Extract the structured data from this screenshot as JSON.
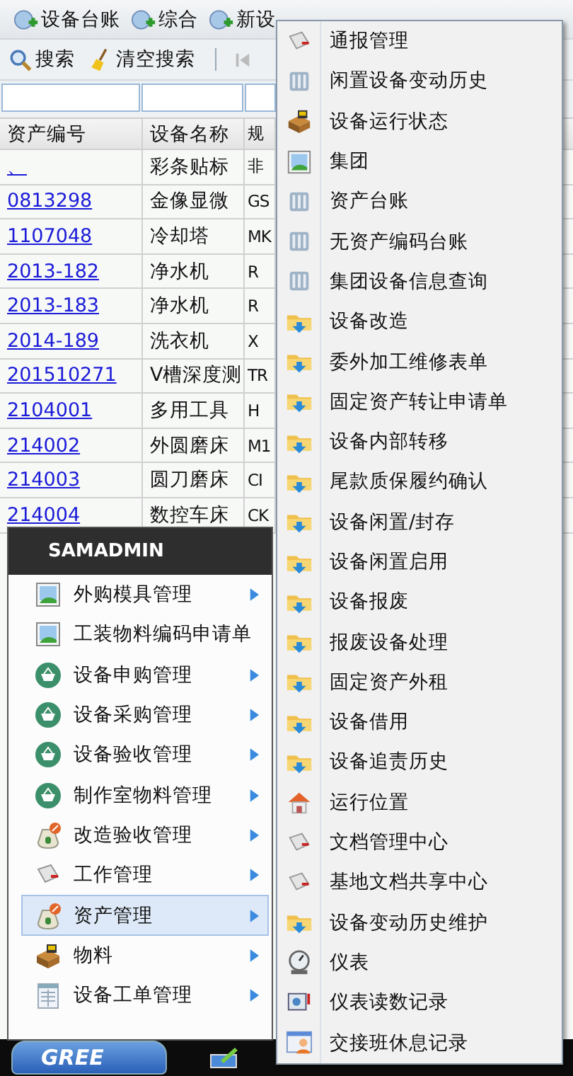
{
  "toolbar_tabs": [
    {
      "label": "设备台账"
    },
    {
      "label": "综合"
    },
    {
      "label": "新设"
    }
  ],
  "search_bar": {
    "buttons": [
      {
        "label": "搜索",
        "kind": "search"
      },
      {
        "label": "清空搜索",
        "kind": "broom"
      }
    ]
  },
  "table": {
    "columns": [
      "资产编号",
      "设备名称",
      "规"
    ],
    "rows": [
      [
        "、",
        "彩条贴标",
        "非"
      ],
      [
        "0813298",
        "金像显微",
        "GS"
      ],
      [
        "1107048",
        "冷却塔",
        "MK"
      ],
      [
        "2013-182",
        "净水机",
        "R"
      ],
      [
        "2013-183",
        "净水机",
        "R"
      ],
      [
        "2014-189",
        "洗衣机",
        "X"
      ],
      [
        "201510271",
        "V槽深度测",
        "TR"
      ],
      [
        "2104001",
        "多用工具",
        "H"
      ],
      [
        "214002",
        "外圆磨床",
        "M1"
      ],
      [
        "214003",
        "圆刀磨床",
        "CI"
      ],
      [
        "214004",
        "数控车床",
        "CK"
      ]
    ]
  },
  "start_menu": {
    "user": "SAMADMIN",
    "items": [
      {
        "label": "外购模具管理",
        "kind": "image",
        "submenu": true,
        "selected": false
      },
      {
        "label": "工装物料编码申请单",
        "kind": "image",
        "submenu": false,
        "selected": false
      },
      {
        "label": "设备申购管理",
        "kind": "basket",
        "submenu": true,
        "selected": false
      },
      {
        "label": "设备采购管理",
        "kind": "basket",
        "submenu": true,
        "selected": false
      },
      {
        "label": "设备验收管理",
        "kind": "basket",
        "submenu": true,
        "selected": false
      },
      {
        "label": "制作室物料管理",
        "kind": "basket",
        "submenu": true,
        "selected": false
      },
      {
        "label": "改造验收管理",
        "kind": "moneybag",
        "submenu": true,
        "selected": false
      },
      {
        "label": "工作管理",
        "kind": "doc",
        "submenu": true,
        "selected": false
      },
      {
        "label": "资产管理",
        "kind": "moneybag",
        "submenu": true,
        "selected": true
      },
      {
        "label": "物料",
        "kind": "box",
        "submenu": true,
        "selected": false
      },
      {
        "label": "设备工单管理",
        "kind": "sheet",
        "submenu": true,
        "selected": false
      }
    ]
  },
  "submenu": {
    "items": [
      {
        "label": "通报管理",
        "kind": "doc"
      },
      {
        "label": "闲置设备变动历史",
        "kind": "chart"
      },
      {
        "label": "设备运行状态",
        "kind": "box"
      },
      {
        "label": "集团",
        "kind": "image"
      },
      {
        "label": "资产台账",
        "kind": "chart"
      },
      {
        "label": "无资产编码台账",
        "kind": "chart"
      },
      {
        "label": "集团设备信息查询",
        "kind": "chart"
      },
      {
        "label": "设备改造",
        "kind": "folder"
      },
      {
        "label": "委外加工维修表单",
        "kind": "folder"
      },
      {
        "label": "固定资产转让申请单",
        "kind": "folder"
      },
      {
        "label": "设备内部转移",
        "kind": "folder"
      },
      {
        "label": "尾款质保履约确认",
        "kind": "folder"
      },
      {
        "label": "设备闲置/封存",
        "kind": "folder"
      },
      {
        "label": "设备闲置启用",
        "kind": "folder"
      },
      {
        "label": "设备报废",
        "kind": "folder"
      },
      {
        "label": "报废设备处理",
        "kind": "folder"
      },
      {
        "label": "固定资产外租",
        "kind": "folder"
      },
      {
        "label": "设备借用",
        "kind": "folder"
      },
      {
        "label": "设备追责历史",
        "kind": "folder"
      },
      {
        "label": "运行位置",
        "kind": "house"
      },
      {
        "label": "文档管理中心",
        "kind": "doc"
      },
      {
        "label": "基地文档共享中心",
        "kind": "doc"
      },
      {
        "label": "设备变动历史维护",
        "kind": "folder"
      },
      {
        "label": "仪表",
        "kind": "gauge"
      },
      {
        "label": "仪表读数记录",
        "kind": "reader"
      },
      {
        "label": "交接班休息记录",
        "kind": "person"
      }
    ]
  },
  "taskbar": {
    "start_label": "GREE"
  }
}
